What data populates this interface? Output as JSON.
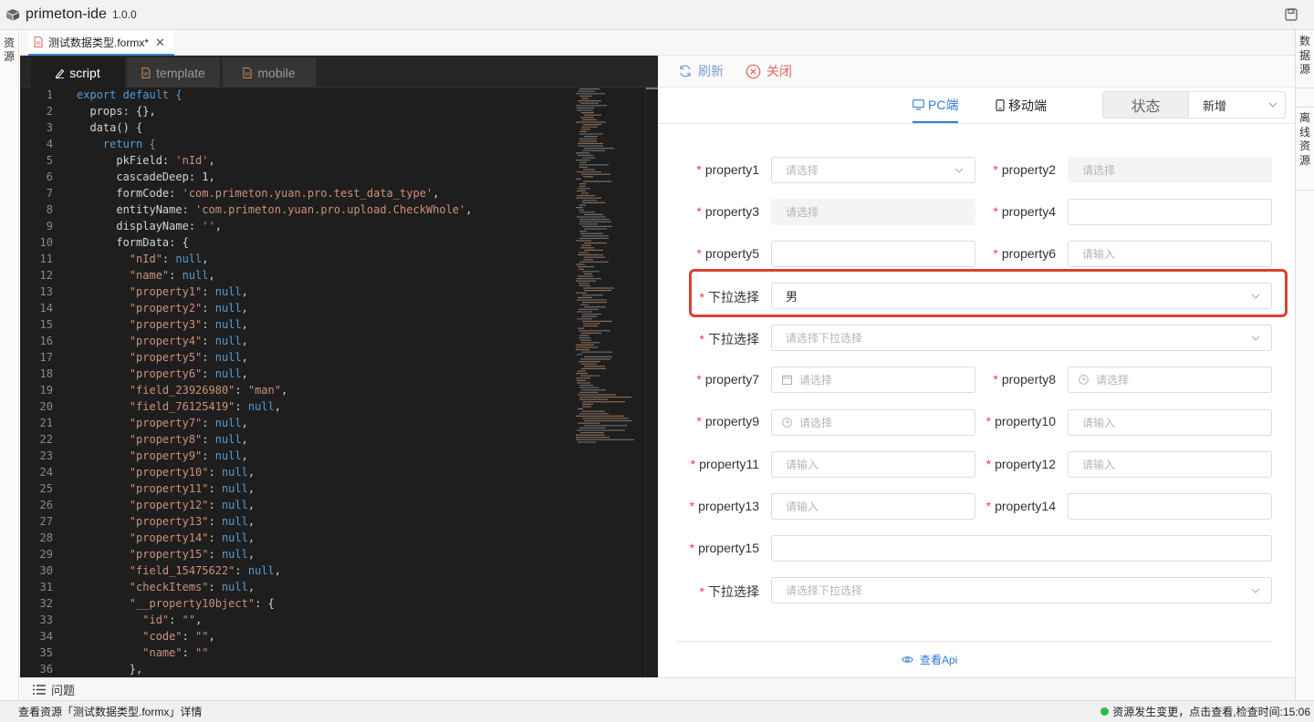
{
  "app": {
    "name": "primeton-ide",
    "version": "1.0.0"
  },
  "left_rail": {
    "label": "资源"
  },
  "right_rail": {
    "datasource": "数据源",
    "offline": "离线资源"
  },
  "file_tab": {
    "label": "测试数据类型.formx*"
  },
  "editor_tabs": [
    {
      "label": "script",
      "icon": "pencil-icon",
      "active": true
    },
    {
      "label": "template",
      "icon": "file-icon",
      "active": false
    },
    {
      "label": "mobile",
      "icon": "file-icon",
      "active": false
    }
  ],
  "code_lines": [
    [
      {
        "t": "export default {",
        "c": "#569cd6"
      }
    ],
    [
      {
        "t": "  props: {},",
        "c": "#d4d4d4"
      }
    ],
    [
      {
        "t": "  data() {",
        "c": "#d4d4d4"
      }
    ],
    [
      {
        "t": "    return {",
        "c": "#569cd6"
      }
    ],
    [
      {
        "t": "      pkField: ",
        "c": "#d4d4d4"
      },
      {
        "t": "'nId'",
        "c": "#ce9178"
      },
      {
        "t": ",",
        "c": "#d4d4d4"
      }
    ],
    [
      {
        "t": "      cascadeDeep: 1,",
        "c": "#d4d4d4"
      }
    ],
    [
      {
        "t": "      formCode: ",
        "c": "#d4d4d4"
      },
      {
        "t": "'com.primeton.yuan.pro.test_data_type'",
        "c": "#ce9178"
      },
      {
        "t": ",",
        "c": "#d4d4d4"
      }
    ],
    [
      {
        "t": "      entityName: ",
        "c": "#d4d4d4"
      },
      {
        "t": "'com.primeton.yuan.pro.upload.CheckWhole'",
        "c": "#ce9178"
      },
      {
        "t": ",",
        "c": "#d4d4d4"
      }
    ],
    [
      {
        "t": "      displayName: ",
        "c": "#d4d4d4"
      },
      {
        "t": "''",
        "c": "#ce9178"
      },
      {
        "t": ",",
        "c": "#d4d4d4"
      }
    ],
    [
      {
        "t": "      formData: {",
        "c": "#d4d4d4"
      }
    ],
    [
      {
        "t": "        \"nId\"",
        "c": "#ce9178"
      },
      {
        "t": ": ",
        "c": "#d4d4d4"
      },
      {
        "t": "null",
        "c": "#569cd6"
      },
      {
        "t": ",",
        "c": "#d4d4d4"
      }
    ],
    [
      {
        "t": "        \"name\"",
        "c": "#ce9178"
      },
      {
        "t": ": ",
        "c": "#d4d4d4"
      },
      {
        "t": "null",
        "c": "#569cd6"
      },
      {
        "t": ",",
        "c": "#d4d4d4"
      }
    ],
    [
      {
        "t": "        \"property1\"",
        "c": "#ce9178"
      },
      {
        "t": ": ",
        "c": "#d4d4d4"
      },
      {
        "t": "null",
        "c": "#569cd6"
      },
      {
        "t": ",",
        "c": "#d4d4d4"
      }
    ],
    [
      {
        "t": "        \"property2\"",
        "c": "#ce9178"
      },
      {
        "t": ": ",
        "c": "#d4d4d4"
      },
      {
        "t": "null",
        "c": "#569cd6"
      },
      {
        "t": ",",
        "c": "#d4d4d4"
      }
    ],
    [
      {
        "t": "        \"property3\"",
        "c": "#ce9178"
      },
      {
        "t": ": ",
        "c": "#d4d4d4"
      },
      {
        "t": "null",
        "c": "#569cd6"
      },
      {
        "t": ",",
        "c": "#d4d4d4"
      }
    ],
    [
      {
        "t": "        \"property4\"",
        "c": "#ce9178"
      },
      {
        "t": ": ",
        "c": "#d4d4d4"
      },
      {
        "t": "null",
        "c": "#569cd6"
      },
      {
        "t": ",",
        "c": "#d4d4d4"
      }
    ],
    [
      {
        "t": "        \"property5\"",
        "c": "#ce9178"
      },
      {
        "t": ": ",
        "c": "#d4d4d4"
      },
      {
        "t": "null",
        "c": "#569cd6"
      },
      {
        "t": ",",
        "c": "#d4d4d4"
      }
    ],
    [
      {
        "t": "        \"property6\"",
        "c": "#ce9178"
      },
      {
        "t": ": ",
        "c": "#d4d4d4"
      },
      {
        "t": "null",
        "c": "#569cd6"
      },
      {
        "t": ",",
        "c": "#d4d4d4"
      }
    ],
    [
      {
        "t": "        \"field_23926980\"",
        "c": "#ce9178"
      },
      {
        "t": ": ",
        "c": "#d4d4d4"
      },
      {
        "t": "\"man\"",
        "c": "#ce9178"
      },
      {
        "t": ",",
        "c": "#d4d4d4"
      }
    ],
    [
      {
        "t": "        \"field_76125419\"",
        "c": "#ce9178"
      },
      {
        "t": ": ",
        "c": "#d4d4d4"
      },
      {
        "t": "null",
        "c": "#569cd6"
      },
      {
        "t": ",",
        "c": "#d4d4d4"
      }
    ],
    [
      {
        "t": "        \"property7\"",
        "c": "#ce9178"
      },
      {
        "t": ": ",
        "c": "#d4d4d4"
      },
      {
        "t": "null",
        "c": "#569cd6"
      },
      {
        "t": ",",
        "c": "#d4d4d4"
      }
    ],
    [
      {
        "t": "        \"property8\"",
        "c": "#ce9178"
      },
      {
        "t": ": ",
        "c": "#d4d4d4"
      },
      {
        "t": "null",
        "c": "#569cd6"
      },
      {
        "t": ",",
        "c": "#d4d4d4"
      }
    ],
    [
      {
        "t": "        \"property9\"",
        "c": "#ce9178"
      },
      {
        "t": ": ",
        "c": "#d4d4d4"
      },
      {
        "t": "null",
        "c": "#569cd6"
      },
      {
        "t": ",",
        "c": "#d4d4d4"
      }
    ],
    [
      {
        "t": "        \"property10\"",
        "c": "#ce9178"
      },
      {
        "t": ": ",
        "c": "#d4d4d4"
      },
      {
        "t": "null",
        "c": "#569cd6"
      },
      {
        "t": ",",
        "c": "#d4d4d4"
      }
    ],
    [
      {
        "t": "        \"property11\"",
        "c": "#ce9178"
      },
      {
        "t": ": ",
        "c": "#d4d4d4"
      },
      {
        "t": "null",
        "c": "#569cd6"
      },
      {
        "t": ",",
        "c": "#d4d4d4"
      }
    ],
    [
      {
        "t": "        \"property12\"",
        "c": "#ce9178"
      },
      {
        "t": ": ",
        "c": "#d4d4d4"
      },
      {
        "t": "null",
        "c": "#569cd6"
      },
      {
        "t": ",",
        "c": "#d4d4d4"
      }
    ],
    [
      {
        "t": "        \"property13\"",
        "c": "#ce9178"
      },
      {
        "t": ": ",
        "c": "#d4d4d4"
      },
      {
        "t": "null",
        "c": "#569cd6"
      },
      {
        "t": ",",
        "c": "#d4d4d4"
      }
    ],
    [
      {
        "t": "        \"property14\"",
        "c": "#ce9178"
      },
      {
        "t": ": ",
        "c": "#d4d4d4"
      },
      {
        "t": "null",
        "c": "#569cd6"
      },
      {
        "t": ",",
        "c": "#d4d4d4"
      }
    ],
    [
      {
        "t": "        \"property15\"",
        "c": "#ce9178"
      },
      {
        "t": ": ",
        "c": "#d4d4d4"
      },
      {
        "t": "null",
        "c": "#569cd6"
      },
      {
        "t": ",",
        "c": "#d4d4d4"
      }
    ],
    [
      {
        "t": "        \"field_15475622\"",
        "c": "#ce9178"
      },
      {
        "t": ": ",
        "c": "#d4d4d4"
      },
      {
        "t": "null",
        "c": "#569cd6"
      },
      {
        "t": ",",
        "c": "#d4d4d4"
      }
    ],
    [
      {
        "t": "        \"checkItems\"",
        "c": "#ce9178"
      },
      {
        "t": ": ",
        "c": "#d4d4d4"
      },
      {
        "t": "null",
        "c": "#569cd6"
      },
      {
        "t": ",",
        "c": "#d4d4d4"
      }
    ],
    [
      {
        "t": "        \"__property10bject\"",
        "c": "#ce9178"
      },
      {
        "t": ": {",
        "c": "#d4d4d4"
      }
    ],
    [
      {
        "t": "          \"id\"",
        "c": "#ce9178"
      },
      {
        "t": ": ",
        "c": "#d4d4d4"
      },
      {
        "t": "\"\"",
        "c": "#ce9178"
      },
      {
        "t": ",",
        "c": "#d4d4d4"
      }
    ],
    [
      {
        "t": "          \"code\"",
        "c": "#ce9178"
      },
      {
        "t": ": ",
        "c": "#d4d4d4"
      },
      {
        "t": "\"\"",
        "c": "#ce9178"
      },
      {
        "t": ",",
        "c": "#d4d4d4"
      }
    ],
    [
      {
        "t": "          \"name\"",
        "c": "#ce9178"
      },
      {
        "t": ": ",
        "c": "#d4d4d4"
      },
      {
        "t": "\"\"",
        "c": "#ce9178"
      }
    ],
    [
      {
        "t": "        },",
        "c": "#d4d4d4"
      }
    ]
  ],
  "toolbar": {
    "refresh": "刷新",
    "close": "关闭"
  },
  "view_tabs": {
    "pc": "PC端",
    "mobile": "移动端"
  },
  "state": {
    "label": "状态",
    "value": "新增"
  },
  "form": {
    "p1": {
      "label": "property1",
      "placeholder": "请选择"
    },
    "p2": {
      "label": "property2",
      "placeholder": "请选择"
    },
    "p3": {
      "label": "property3",
      "placeholder": "请选择"
    },
    "p4": {
      "label": "property4",
      "placeholder": ""
    },
    "p5": {
      "label": "property5",
      "placeholder": ""
    },
    "p6": {
      "label": "property6",
      "placeholder": "请输入"
    },
    "dd1": {
      "label": "下拉选择",
      "value": "男"
    },
    "dd2": {
      "label": "下拉选择",
      "placeholder": "请选择下拉选择"
    },
    "p7": {
      "label": "property7",
      "placeholder": "请选择"
    },
    "p8": {
      "label": "property8",
      "placeholder": "请选择"
    },
    "p9": {
      "label": "property9",
      "placeholder": "请选择"
    },
    "p10": {
      "label": "property10",
      "placeholder": "请输入"
    },
    "p11": {
      "label": "property11",
      "placeholder": "请输入"
    },
    "p12": {
      "label": "property12",
      "placeholder": "请输入"
    },
    "p13": {
      "label": "property13",
      "placeholder": "请输入"
    },
    "p14": {
      "label": "property14",
      "placeholder": ""
    },
    "p15": {
      "label": "property15",
      "placeholder": ""
    },
    "dd3": {
      "label": "下拉选择",
      "placeholder": "请选择下拉选择"
    }
  },
  "api_link": "查看Api",
  "problems": {
    "label": "问题"
  },
  "status": {
    "left": "查看资源「测试数据类型.formx」详情",
    "right": "资源发生变更，点击查看,检查时间:15:06"
  },
  "colors": {
    "accent": "#2d7bd8",
    "required": "#e4463e",
    "highlight": "#d8412f",
    "status_ok": "#2fb84e"
  }
}
